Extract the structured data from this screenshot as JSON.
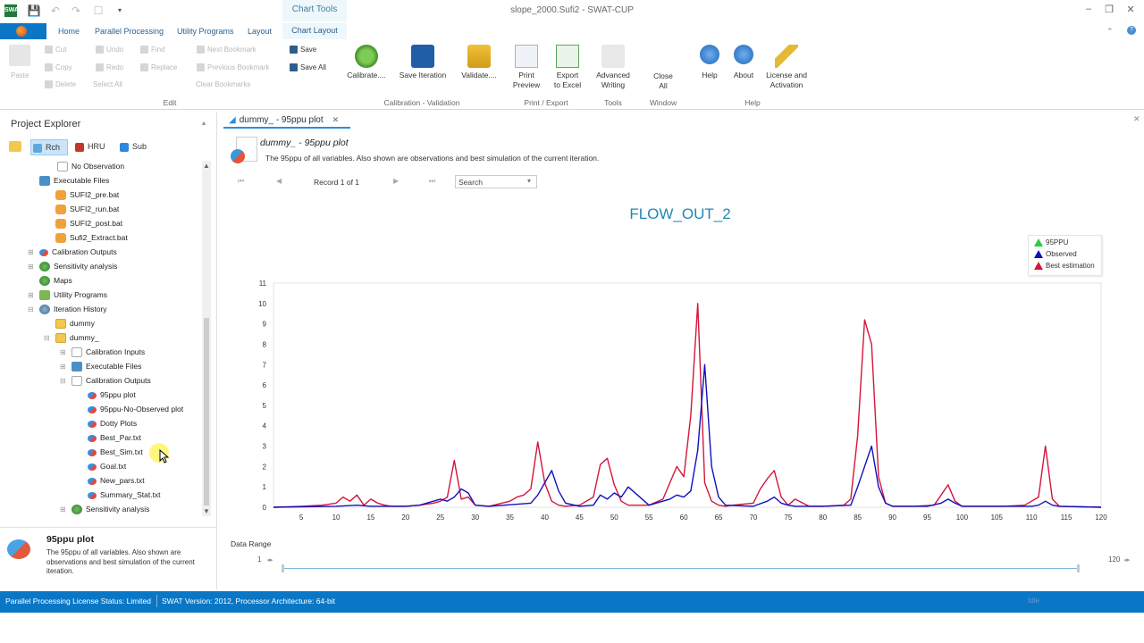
{
  "window": {
    "title": "slope_2000.Sufi2 - SWAT-CUP",
    "app_icon": "SWAT",
    "context_tab": "Chart Tools"
  },
  "ribbon": {
    "tabs": [
      {
        "label": "Home"
      },
      {
        "label": "Parallel Processing"
      },
      {
        "label": "Utility Programs"
      },
      {
        "label": "Layout"
      },
      {
        "label": "Chart Layout"
      }
    ],
    "edit": {
      "paste": "Paste",
      "cut": "Cut",
      "copy": "Copy",
      "delete": "Delete",
      "undo": "Undo",
      "redo": "Redo",
      "select_all": "Select All",
      "find": "Find",
      "replace": "Replace",
      "next_bookmark": "Next Bookmark",
      "previous_bookmark": "Previous Bookmark",
      "clear_bookmarks": "Clear Bookmarks",
      "save": "Save",
      "save_all": "Save All",
      "group": "Edit"
    },
    "calibration": {
      "calibrate": "Calibrate....",
      "save_iteration": "Save Iteration",
      "validate": "Validate....",
      "group": "Calibration - Validation"
    },
    "print_export": {
      "print_preview_1": "Print",
      "print_preview_2": "Preview",
      "export_1": "Export",
      "export_2": "to Excel",
      "group": "Print / Export"
    },
    "tools": {
      "advanced_1": "Advanced",
      "advanced_2": "Writing",
      "group": "Tools"
    },
    "window_grp": {
      "close_1": "Close",
      "close_2": "All",
      "group": "Window"
    },
    "help": {
      "help": "Help",
      "about": "About",
      "license_1": "License and",
      "license_2": "Activation",
      "group": "Help"
    }
  },
  "explorer": {
    "title": "Project Explorer",
    "tabs": [
      {
        "label": "Rch"
      },
      {
        "label": "HRU"
      },
      {
        "label": "Sub"
      }
    ],
    "tree": [
      {
        "label": "No Observation",
        "icon": "doc-icon"
      },
      {
        "label": "Executable Files",
        "icon": "files-icon"
      },
      {
        "label": "SUFI2_pre.bat",
        "icon": "bat-icon"
      },
      {
        "label": "SUFI2_run.bat",
        "icon": "bat-icon"
      },
      {
        "label": "SUFI2_post.bat",
        "icon": "bat-icon"
      },
      {
        "label": "Sufi2_Extract.bat",
        "icon": "bat-icon"
      },
      {
        "label": "Calibration Outputs",
        "icon": "chart-icon"
      },
      {
        "label": "Sensitivity analysis",
        "icon": "globe-icon"
      },
      {
        "label": "Maps",
        "icon": "globe-icon"
      },
      {
        "label": "Utility Programs",
        "icon": "check-icon"
      },
      {
        "label": "Iteration History",
        "icon": "iteration-icon"
      },
      {
        "label": "dummy",
        "icon": "folder-icon"
      },
      {
        "label": "dummy_",
        "icon": "folder-icon"
      },
      {
        "label": "Calibration Inputs",
        "icon": "doc-icon"
      },
      {
        "label": "Executable Files",
        "icon": "files-icon"
      },
      {
        "label": "Calibration Outputs",
        "icon": "chart-icon"
      },
      {
        "label": "95ppu plot",
        "icon": "chart-icon"
      },
      {
        "label": "95ppu-No-Observed plot",
        "icon": "chart-icon"
      },
      {
        "label": "Dotty Plots",
        "icon": "chart-icon"
      },
      {
        "label": "Best_Par.txt",
        "icon": "chart-icon"
      },
      {
        "label": "Best_Sim.txt",
        "icon": "chart-icon"
      },
      {
        "label": "Goal.txt",
        "icon": "chart-icon"
      },
      {
        "label": "New_pars.txt",
        "icon": "chart-icon"
      },
      {
        "label": "Summary_Stat.txt",
        "icon": "chart-icon"
      },
      {
        "label": "Sensitivity analysis",
        "icon": "globe-icon"
      }
    ],
    "desc_title": "95ppu plot",
    "desc_text": "The 95ppu of all variables. Also shown are observations and best simulation of the current iteration."
  },
  "document": {
    "tab_label": "dummy_ - 95ppu plot",
    "header_title": "dummy_ - 95ppu plot",
    "header_desc": "The 95ppu of all variables. Also shown are observations and best simulation of the current iteration.",
    "record": "Record 1 of 1",
    "search_placeholder": "Search"
  },
  "chart_data": {
    "type": "line",
    "title": "FLOW_OUT_2",
    "xlim": [
      1,
      120
    ],
    "ylim": [
      0,
      11
    ],
    "xticks": [
      5,
      10,
      15,
      20,
      25,
      30,
      35,
      40,
      45,
      50,
      55,
      60,
      65,
      70,
      75,
      80,
      85,
      90,
      95,
      100,
      105,
      110,
      115,
      120
    ],
    "yticks": [
      0,
      1,
      2,
      3,
      4,
      5,
      6,
      7,
      8,
      9,
      10,
      11
    ],
    "legend": "top-right",
    "legend_entries": [
      "95PPU",
      "Observed",
      "Best estimation"
    ],
    "colors": {
      "ppu": "#2ecc40",
      "observed": "#1010c0",
      "best": "#d4153b"
    },
    "series": [
      {
        "name": "Best estimation",
        "x": [
          1,
          5,
          8,
          10,
          11,
          12,
          13,
          14,
          15,
          16,
          17,
          18,
          20,
          22,
          24,
          25,
          26,
          27,
          28,
          29,
          30,
          32,
          35,
          36,
          37,
          38,
          39,
          40,
          41,
          42,
          43,
          45,
          47,
          48,
          49,
          50,
          51,
          52,
          55,
          57,
          58,
          59,
          60,
          61,
          62,
          63,
          64,
          65,
          66,
          67,
          70,
          71,
          72,
          73,
          74,
          75,
          76,
          78,
          80,
          83,
          84,
          85,
          86,
          87,
          88,
          89,
          90,
          93,
          96,
          97,
          98,
          99,
          100,
          103,
          106,
          109,
          110,
          111,
          112,
          113,
          114,
          117,
          120
        ],
        "y": [
          0,
          0.05,
          0.1,
          0.2,
          0.5,
          0.3,
          0.6,
          0.1,
          0.4,
          0.2,
          0.1,
          0.05,
          0.05,
          0.1,
          0.2,
          0.3,
          0.5,
          2.3,
          0.4,
          0.5,
          0.1,
          0.05,
          0.3,
          0.5,
          0.6,
          0.9,
          3.2,
          1.2,
          0.3,
          0.1,
          0.05,
          0.1,
          0.5,
          2.1,
          2.4,
          1.1,
          0.3,
          0.1,
          0.1,
          0.4,
          1.2,
          2,
          1.5,
          4.5,
          10,
          1.2,
          0.3,
          0.1,
          0.05,
          0.1,
          0.2,
          0.9,
          1.4,
          1.8,
          0.5,
          0.1,
          0.4,
          0.05,
          0.05,
          0.1,
          0.4,
          3.5,
          9.2,
          8,
          1.5,
          0.2,
          0.05,
          0.05,
          0.1,
          0.6,
          1.1,
          0.3,
          0.05,
          0.05,
          0.05,
          0.1,
          0.3,
          0.5,
          3,
          0.4,
          0.05,
          0.02,
          0
        ]
      },
      {
        "name": "Observed",
        "x": [
          1,
          10,
          13,
          15,
          20,
          22,
          24,
          25,
          26,
          27,
          28,
          29,
          30,
          32,
          38,
          39,
          40,
          41,
          42,
          43,
          45,
          47,
          48,
          49,
          50,
          51,
          52,
          55,
          58,
          59,
          60,
          61,
          62,
          63,
          64,
          65,
          66,
          70,
          72,
          73,
          74,
          75,
          76,
          80,
          84,
          85,
          86,
          87,
          88,
          89,
          90,
          95,
          97,
          98,
          99,
          100,
          110,
          111,
          112,
          113,
          114,
          120
        ],
        "y": [
          0,
          0.05,
          0.1,
          0.05,
          0.05,
          0.1,
          0.3,
          0.4,
          0.3,
          0.5,
          0.9,
          0.7,
          0.1,
          0.05,
          0.2,
          0.6,
          1.2,
          1.8,
          0.8,
          0.2,
          0.05,
          0.1,
          0.6,
          0.4,
          0.7,
          0.5,
          1,
          0.1,
          0.4,
          0.6,
          0.5,
          0.8,
          2.8,
          7,
          2,
          0.5,
          0.1,
          0.05,
          0.3,
          0.5,
          0.2,
          0.1,
          0.05,
          0.05,
          0.1,
          1,
          2,
          3,
          1,
          0.2,
          0.05,
          0.05,
          0.2,
          0.4,
          0.2,
          0.05,
          0.05,
          0.1,
          0.3,
          0.1,
          0.05,
          0
        ]
      }
    ]
  },
  "data_range": {
    "label": "Data Range",
    "min": "1",
    "max": "120"
  },
  "status": {
    "license": "Parallel Processing License Status: Limited",
    "version": "SWAT Version: 2012, Processor Architecture: 64-bit",
    "right": "Idle"
  }
}
